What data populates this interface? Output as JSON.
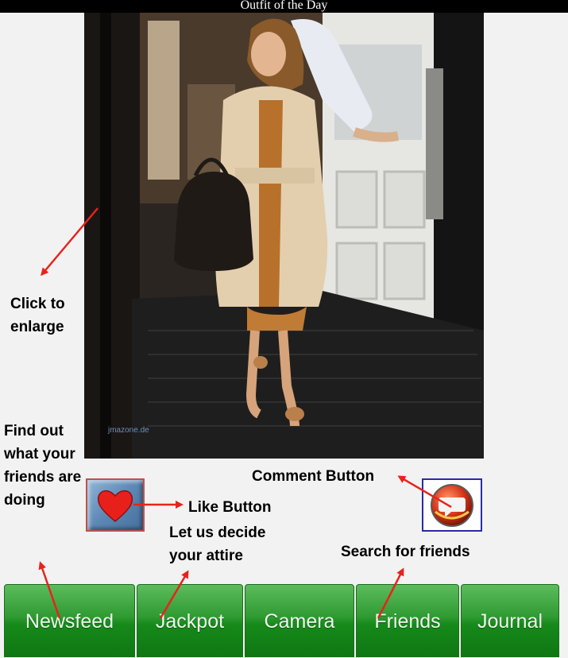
{
  "app": {
    "title": "Outfit of the Day"
  },
  "photo": {
    "watermark": "jmazone.de"
  },
  "annotations": {
    "click_to_enlarge": "Click to enlarge",
    "find_out_friends": "Find out what your friends are doing",
    "like_button": "Like Button",
    "let_us_decide": "Let us decide your attire",
    "comment_button": "Comment Button",
    "search_for_friends": "Search for friends"
  },
  "actions": {
    "like_icon": "heart-icon",
    "comment_icon": "speech-bubble-icon"
  },
  "nav": {
    "items": [
      {
        "label": "Newsfeed"
      },
      {
        "label": "Jackpot"
      },
      {
        "label": "Camera"
      },
      {
        "label": "Friends"
      },
      {
        "label": "Journal"
      }
    ]
  },
  "colors": {
    "annotation_arrow": "#e8231c",
    "nav_green": "#2f9a32",
    "like_border": "#c0504d",
    "comment_border": "#2a2aa8"
  }
}
